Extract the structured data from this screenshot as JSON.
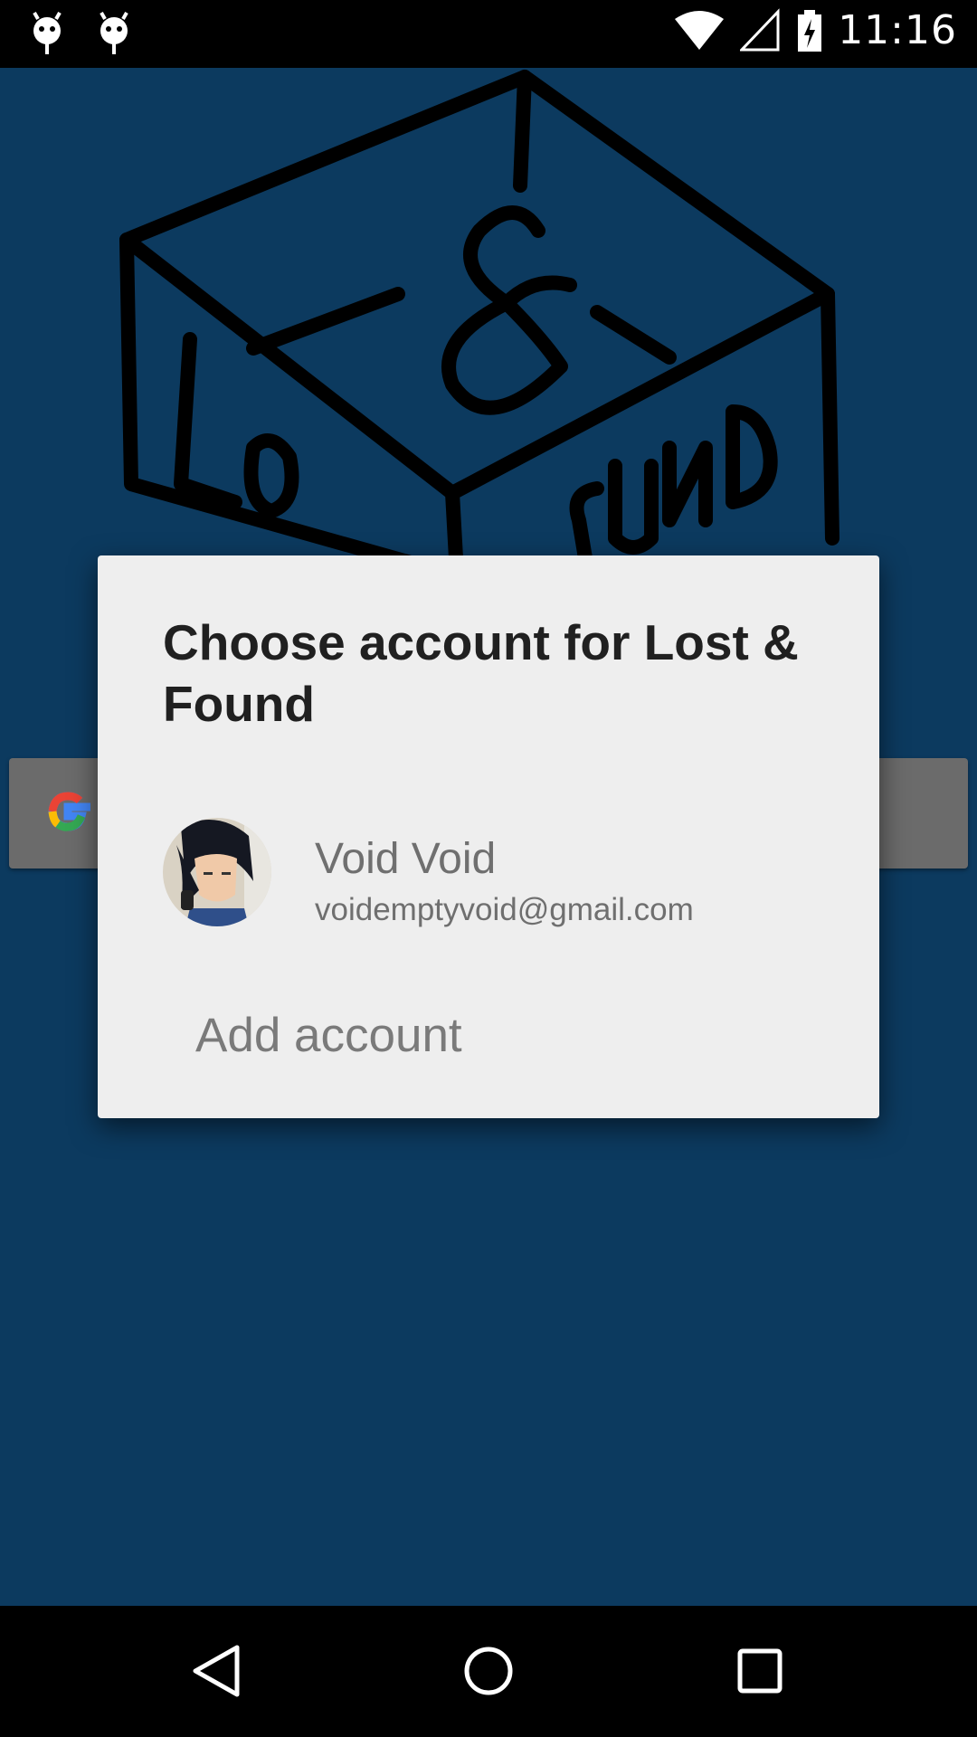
{
  "status_bar": {
    "time": "11:16",
    "notification_icons": [
      "android-debug-icon",
      "android-debug-icon"
    ],
    "system_icons": [
      "wifi-icon",
      "signal-icon",
      "battery-charging-icon"
    ]
  },
  "app": {
    "background_color": "#0c3a5f",
    "logo_icon": "lost-and-found-box-logo",
    "signin_button_icon": "google-g-icon"
  },
  "dialog": {
    "title": "Choose account for Lost & Found",
    "account": {
      "name": "Void Void",
      "email": "voidemptyvoid@gmail.com",
      "avatar_icon": "avatar"
    },
    "add_account_label": "Add account"
  },
  "nav_bar": {
    "buttons": [
      "back-icon",
      "home-icon",
      "recents-icon"
    ]
  }
}
